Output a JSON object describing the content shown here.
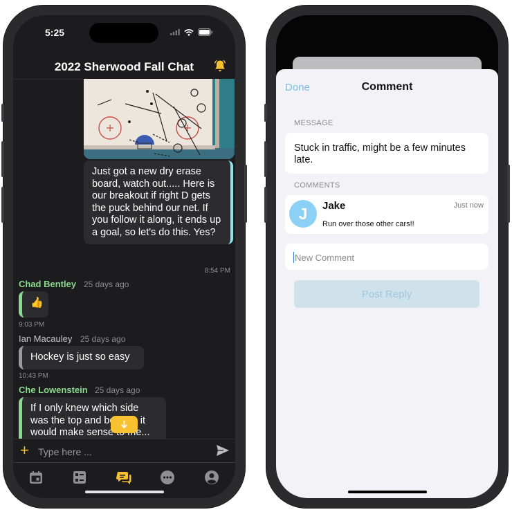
{
  "left_phone": {
    "status": {
      "time": "5:25"
    },
    "header": {
      "title": "2022 Sherwood Fall Chat"
    },
    "messages": {
      "mine": {
        "text": "Just got a new dry erase board, watch out..... Here is our breakout if right D gets the puck behind our net. If you follow it along, it ends up a goal, so let's do this. Yes?",
        "time": "8:54 PM"
      },
      "m1": {
        "author": "Chad Bentley",
        "ago": "25 days ago",
        "text": "👍",
        "time": "9:03 PM"
      },
      "m2": {
        "author": "Ian Macauley",
        "ago": "25 days ago",
        "text": "Hockey is just so easy",
        "time": "10:43 PM"
      },
      "m3": {
        "author": "Che Lowenstein",
        "ago": "25 days ago",
        "text": "If I only knew which side was the top and bottom, it would make sense to me..."
      }
    },
    "composer": {
      "placeholder": "Type here ..."
    },
    "colors": {
      "accent": "#f7c12f",
      "green_author": "#8ad98f",
      "gray_author": "#c8c8cc",
      "mine_border": "#8fe5ea"
    },
    "tabs": [
      "calendar-icon",
      "checklist-icon",
      "chat-icon",
      "more-icon",
      "profile-icon"
    ]
  },
  "right_phone": {
    "sheet": {
      "done_label": "Done",
      "title": "Comment"
    },
    "message_label": "MESSAGE",
    "message_text": "Stuck in traffic, might be a few minutes late.",
    "comments_label": "COMMENTS",
    "comment": {
      "initial": "J",
      "author": "Jake",
      "time": "Just now",
      "text": "Run over those other cars!!"
    },
    "new_comment_placeholder": "New Comment",
    "post_label": "Post Reply",
    "colors": {
      "link": "#7cbfe3",
      "avatar": "#8cd0f5",
      "post_bg": "#cfe2ec"
    }
  }
}
